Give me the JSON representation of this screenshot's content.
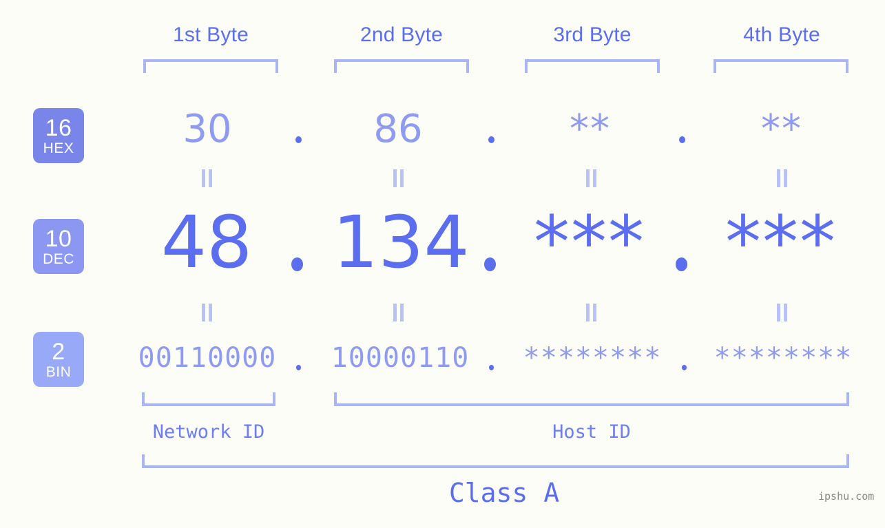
{
  "background_color": "#fcfdf7",
  "accent_colors": {
    "strong_blue": "#5c6ef0",
    "mid_blue": "#8e9bf0",
    "light_blue": "#aab5f5",
    "badge_hex": "#7985e8",
    "badge_dec": "#8b97f0",
    "badge_bin": "#97a9f7",
    "watermark_gray": "#888888"
  },
  "byte_headers": [
    {
      "label": "1st Byte"
    },
    {
      "label": "2nd Byte"
    },
    {
      "label": "3rd Byte"
    },
    {
      "label": "4th Byte"
    }
  ],
  "bases": [
    {
      "number": "16",
      "name": "HEX"
    },
    {
      "number": "10",
      "name": "DEC"
    },
    {
      "number": "2",
      "name": "BIN"
    }
  ],
  "rows": {
    "hex": {
      "base_number": "16",
      "base_name": "HEX",
      "values": [
        "30",
        "86",
        "**",
        "**"
      ],
      "separator": "."
    },
    "dec": {
      "base_number": "10",
      "base_name": "DEC",
      "values": [
        "48",
        "134",
        "***",
        "***"
      ],
      "separator": "."
    },
    "bin": {
      "base_number": "2",
      "base_name": "BIN",
      "values": [
        "00110000",
        "10000110",
        "********",
        "********"
      ],
      "separator": "."
    }
  },
  "equality_marker": "||",
  "segments": {
    "network_id": "Network ID",
    "host_id": "Host ID",
    "class": "Class A"
  },
  "watermark": "ipshu.com"
}
